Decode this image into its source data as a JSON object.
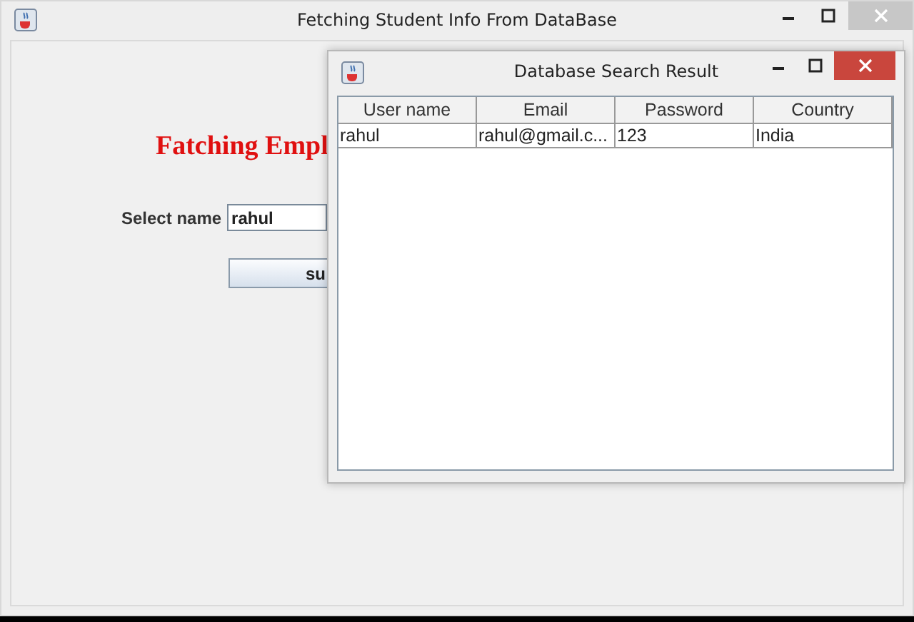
{
  "main_window": {
    "title": "Fetching Student Info From DataBase",
    "heading": "Fatching Empl",
    "name_label": "Select name",
    "name_field": {
      "value": "rahul"
    },
    "submit_button": "su"
  },
  "result_window": {
    "title": "Database Search Result",
    "table": {
      "columns": [
        "User name",
        "Email",
        "Password",
        "Country"
      ],
      "rows": [
        [
          "rahul",
          "rahul@gmail.c...",
          "123",
          "India"
        ]
      ]
    }
  }
}
